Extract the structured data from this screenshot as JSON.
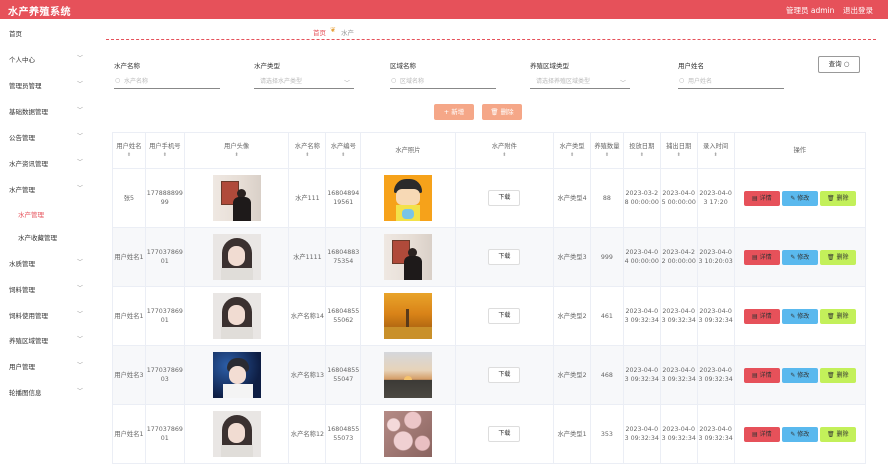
{
  "app": {
    "title": "水产养殖系统",
    "user_label": "管理员 admin",
    "logout_label": "退出登录"
  },
  "sidebar": {
    "items": [
      {
        "label": "首页",
        "has_arrow": false
      },
      {
        "label": "个人中心",
        "has_arrow": true
      },
      {
        "label": "管理员管理",
        "has_arrow": true
      },
      {
        "label": "基础数据管理",
        "has_arrow": true
      },
      {
        "label": "公告管理",
        "has_arrow": true
      },
      {
        "label": "水产资讯管理",
        "has_arrow": true
      },
      {
        "label": "水产管理",
        "has_arrow": true
      },
      {
        "label": "水产管理",
        "sub": true,
        "active": true
      },
      {
        "label": "水产收藏管理",
        "sub": true
      },
      {
        "label": "水质管理",
        "has_arrow": true
      },
      {
        "label": "饲料管理",
        "has_arrow": true
      },
      {
        "label": "饲料使用管理",
        "has_arrow": true
      },
      {
        "label": "养殖区域管理",
        "has_arrow": true
      },
      {
        "label": "用户管理",
        "has_arrow": true
      },
      {
        "label": "轮播图信息",
        "has_arrow": true
      }
    ]
  },
  "breadcrumb": {
    "home": "首页",
    "current": "水产"
  },
  "filters": {
    "name": {
      "label": "水产名称",
      "placeholder": "水产名称"
    },
    "type": {
      "label": "水产类型",
      "placeholder": "请选择水产类型"
    },
    "area_name": {
      "label": "区域名称",
      "placeholder": "区域名称"
    },
    "area_type": {
      "label": "养殖区域类型",
      "placeholder": "请选择养殖区域类型"
    },
    "user_name": {
      "label": "用户姓名",
      "placeholder": "用户姓名"
    },
    "query_label": "查询"
  },
  "toolbar": {
    "add_label": "新增",
    "delete_label": "删除"
  },
  "table": {
    "headers": [
      "用户姓名",
      "用户手机号",
      "用户头像",
      "水产名称",
      "水产编号",
      "水产照片",
      "水产附件",
      "水产类型",
      "养殖数量",
      "投放日期",
      "捕出日期",
      "录入时间",
      "操作"
    ],
    "download_label": "下载",
    "actions": {
      "detail": "详情",
      "edit": "修改",
      "delete": "删除"
    },
    "rows": [
      {
        "user_name": "张5",
        "phone": "17788889999",
        "aqua_name": "水产111",
        "aqua_no": "1680489419561",
        "aqua_type": "水产类型4",
        "count": "88",
        "release_date": "2023-03-28 00:00:00",
        "catch_date": "2023-04-05 00:00:00",
        "record_time": "2023-04-03 17:20",
        "avatar": "person-red",
        "photo": "cartoon"
      },
      {
        "user_name": "用户姓名1",
        "phone": "17703786901",
        "aqua_name": "水产1111",
        "aqua_no": "1680488375354",
        "aqua_type": "水产类型3",
        "count": "999",
        "release_date": "2023-04-04 00:00:00",
        "catch_date": "2023-04-22 00:00:00",
        "record_time": "2023-04-03 10:20:03",
        "avatar": "girl",
        "photo": "person-red"
      },
      {
        "user_name": "用户姓名1",
        "phone": "17703786901",
        "aqua_name": "水产名称14",
        "aqua_no": "1680485555062",
        "aqua_type": "水产类型2",
        "count": "461",
        "release_date": "2023-04-03 09:32:34",
        "catch_date": "2023-04-03 09:32:34",
        "record_time": "2023-04-03 09:32:34",
        "avatar": "girl",
        "photo": "autumn"
      },
      {
        "user_name": "用户姓名3",
        "phone": "17703786903",
        "aqua_name": "水产名称13",
        "aqua_no": "1680485555047",
        "aqua_type": "水产类型2",
        "count": "468",
        "release_date": "2023-04-03 09:32:34",
        "catch_date": "2023-04-03 09:32:34",
        "record_time": "2023-04-03 09:32:34",
        "avatar": "boy",
        "photo": "sunset"
      },
      {
        "user_name": "用户姓名1",
        "phone": "17703786901",
        "aqua_name": "水产名称12",
        "aqua_no": "1680485555073",
        "aqua_type": "水产类型1",
        "count": "353",
        "release_date": "2023-04-03 09:32:34",
        "catch_date": "2023-04-03 09:32:34",
        "record_time": "2023-04-03 09:32:34",
        "avatar": "girl",
        "photo": "blossom"
      }
    ]
  }
}
